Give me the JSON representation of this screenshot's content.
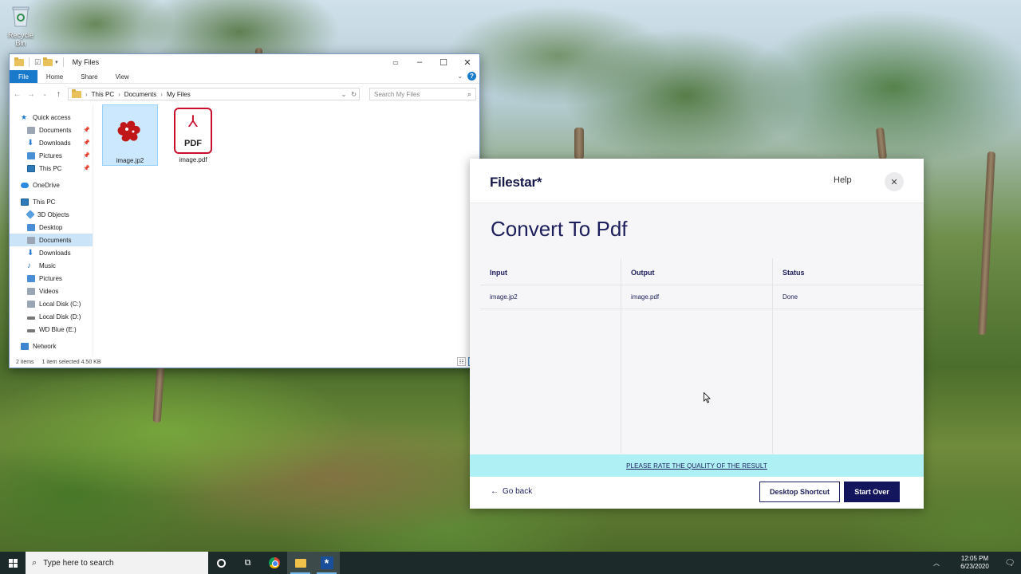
{
  "desktop": {
    "recycle_bin_label": "Recycle Bin"
  },
  "explorer": {
    "title": "My Files",
    "ribbon_tabs": [
      "File",
      "Home",
      "Share",
      "View"
    ],
    "breadcrumb": [
      "This PC",
      "Documents",
      "My Files"
    ],
    "search_placeholder": "Search My Files",
    "nav": {
      "quick_access": "Quick access",
      "qa_items": [
        "Documents",
        "Downloads",
        "Pictures",
        "This PC"
      ],
      "onedrive": "OneDrive",
      "this_pc": "This PC",
      "pc_items": [
        "3D Objects",
        "Desktop",
        "Documents",
        "Downloads",
        "Music",
        "Pictures",
        "Videos",
        "Local Disk (C:)",
        "Local Disk (D:)",
        "WD Blue (E:)"
      ],
      "network": "Network"
    },
    "files": [
      {
        "name": "image.jp2",
        "selected": true
      },
      {
        "name": "image.pdf",
        "badge": "PDF",
        "selected": false
      }
    ],
    "status": {
      "items": "2 items",
      "selection": "1 item selected  4.50 KB"
    }
  },
  "filestar": {
    "logo": "Filestar*",
    "help": "Help",
    "title": "Convert To Pdf",
    "columns": [
      "Input",
      "Output",
      "Status"
    ],
    "rows": [
      {
        "input": "image.jp2",
        "output": "image.pdf",
        "status": "Done"
      }
    ],
    "rate_text": "PLEASE RATE THE QUALITY OF THE RESULT",
    "back_label": "Go back",
    "shortcut_label": "Desktop Shortcut",
    "start_over_label": "Start Over",
    "colors": {
      "primary": "#13165c",
      "rate_bar": "#aef0f4"
    }
  },
  "taskbar": {
    "search_placeholder": "Type here to search",
    "time": "12:05 PM",
    "date": "6/23/2020"
  }
}
